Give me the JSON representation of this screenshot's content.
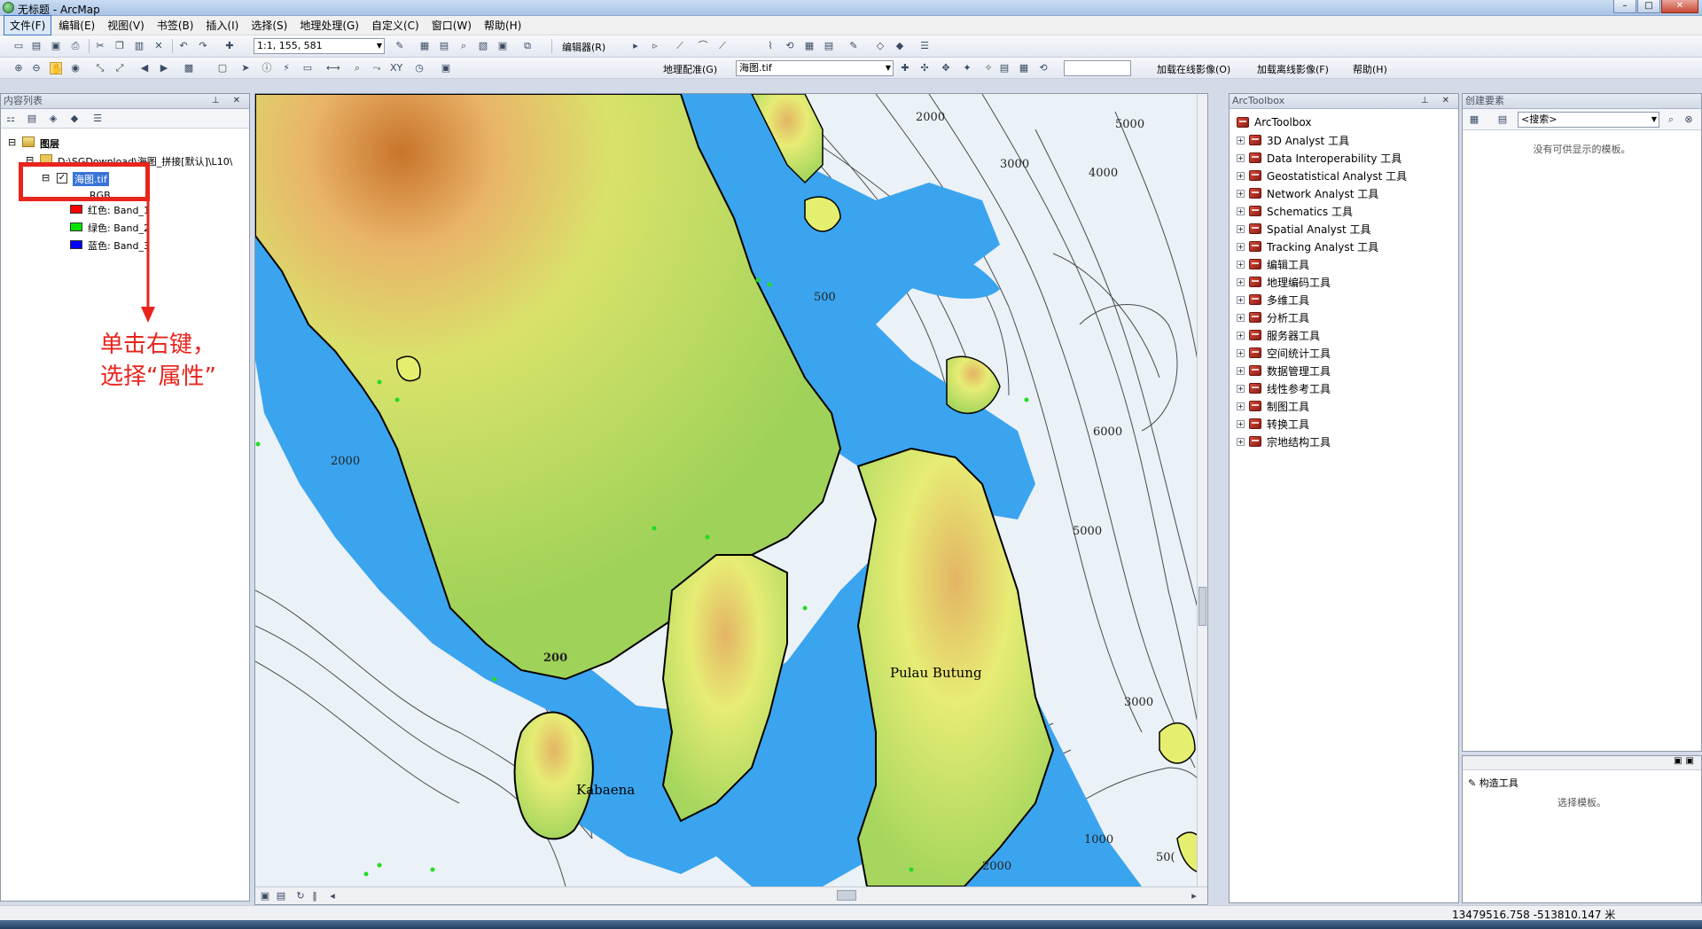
{
  "window": {
    "title": "无标题 - ArcMap"
  },
  "menubar": {
    "items": [
      "文件(F)",
      "编辑(E)",
      "视图(V)",
      "书签(B)",
      "插入(I)",
      "选择(S)",
      "地理处理(G)",
      "自定义(C)",
      "窗口(W)",
      "帮助(H)"
    ]
  },
  "toolbar1": {
    "scale": "1:1, 155, 581",
    "editor_label": "编辑器(R)"
  },
  "toolbar2": {
    "georef_label": "地理配准(G)",
    "layer_select": "海图.tif",
    "online_image_label": "加载在线影像(O)",
    "offline_image_label": "加载离线影像(F)",
    "help_label": "帮助(H)"
  },
  "toc": {
    "title": "内容列表",
    "root_label": "图层",
    "path_label": "D:\\SGDownload\\海图_拼接[默认]\\L10\\",
    "layer_name": "海图.tif",
    "rgb_label": "RGB",
    "bands": [
      {
        "label": "红色:   Band_1",
        "color": "#ff0000"
      },
      {
        "label": "绿色: Band_2",
        "color": "#00e400"
      },
      {
        "label": "蓝色:   Band_3",
        "color": "#0000ff"
      }
    ]
  },
  "annotation": {
    "line1": "单击右键，",
    "line2": "选择“属性”"
  },
  "map": {
    "place_labels": [
      "Pulau Butung",
      "Kabaena"
    ],
    "contour_labels": [
      "2000",
      "5000",
      "3000",
      "4000",
      "500",
      "6000",
      "2000",
      "5000",
      "200",
      "3000",
      "1000",
      "2000",
      "50("
    ],
    "colors": {
      "sea": "#3aa4ef",
      "deep": "#eaf1f7",
      "land_low": "#e5ef6f",
      "land_mid": "#a9d75c",
      "land_high": "#c8742a"
    }
  },
  "toolbox": {
    "title": "ArcToolbox",
    "root": "ArcToolbox",
    "items": [
      "3D Analyst 工具",
      "Data Interoperability 工具",
      "Geostatistical Analyst 工具",
      "Network Analyst 工具",
      "Schematics 工具",
      "Spatial Analyst 工具",
      "Tracking Analyst 工具",
      "编辑工具",
      "地理编码工具",
      "多维工具",
      "分析工具",
      "服务器工具",
      "空间统计工具",
      "数据管理工具",
      "线性参考工具",
      "制图工具",
      "转换工具",
      "宗地结构工具"
    ]
  },
  "create_features": {
    "title": "创建要素",
    "search_placeholder": "<搜索>",
    "empty_message": "没有可供显示的模板。"
  },
  "construct_tools": {
    "title": "构造工具",
    "message": "选择模板。"
  },
  "status": {
    "coordinates": "13479516.758  -513810.147 米"
  }
}
